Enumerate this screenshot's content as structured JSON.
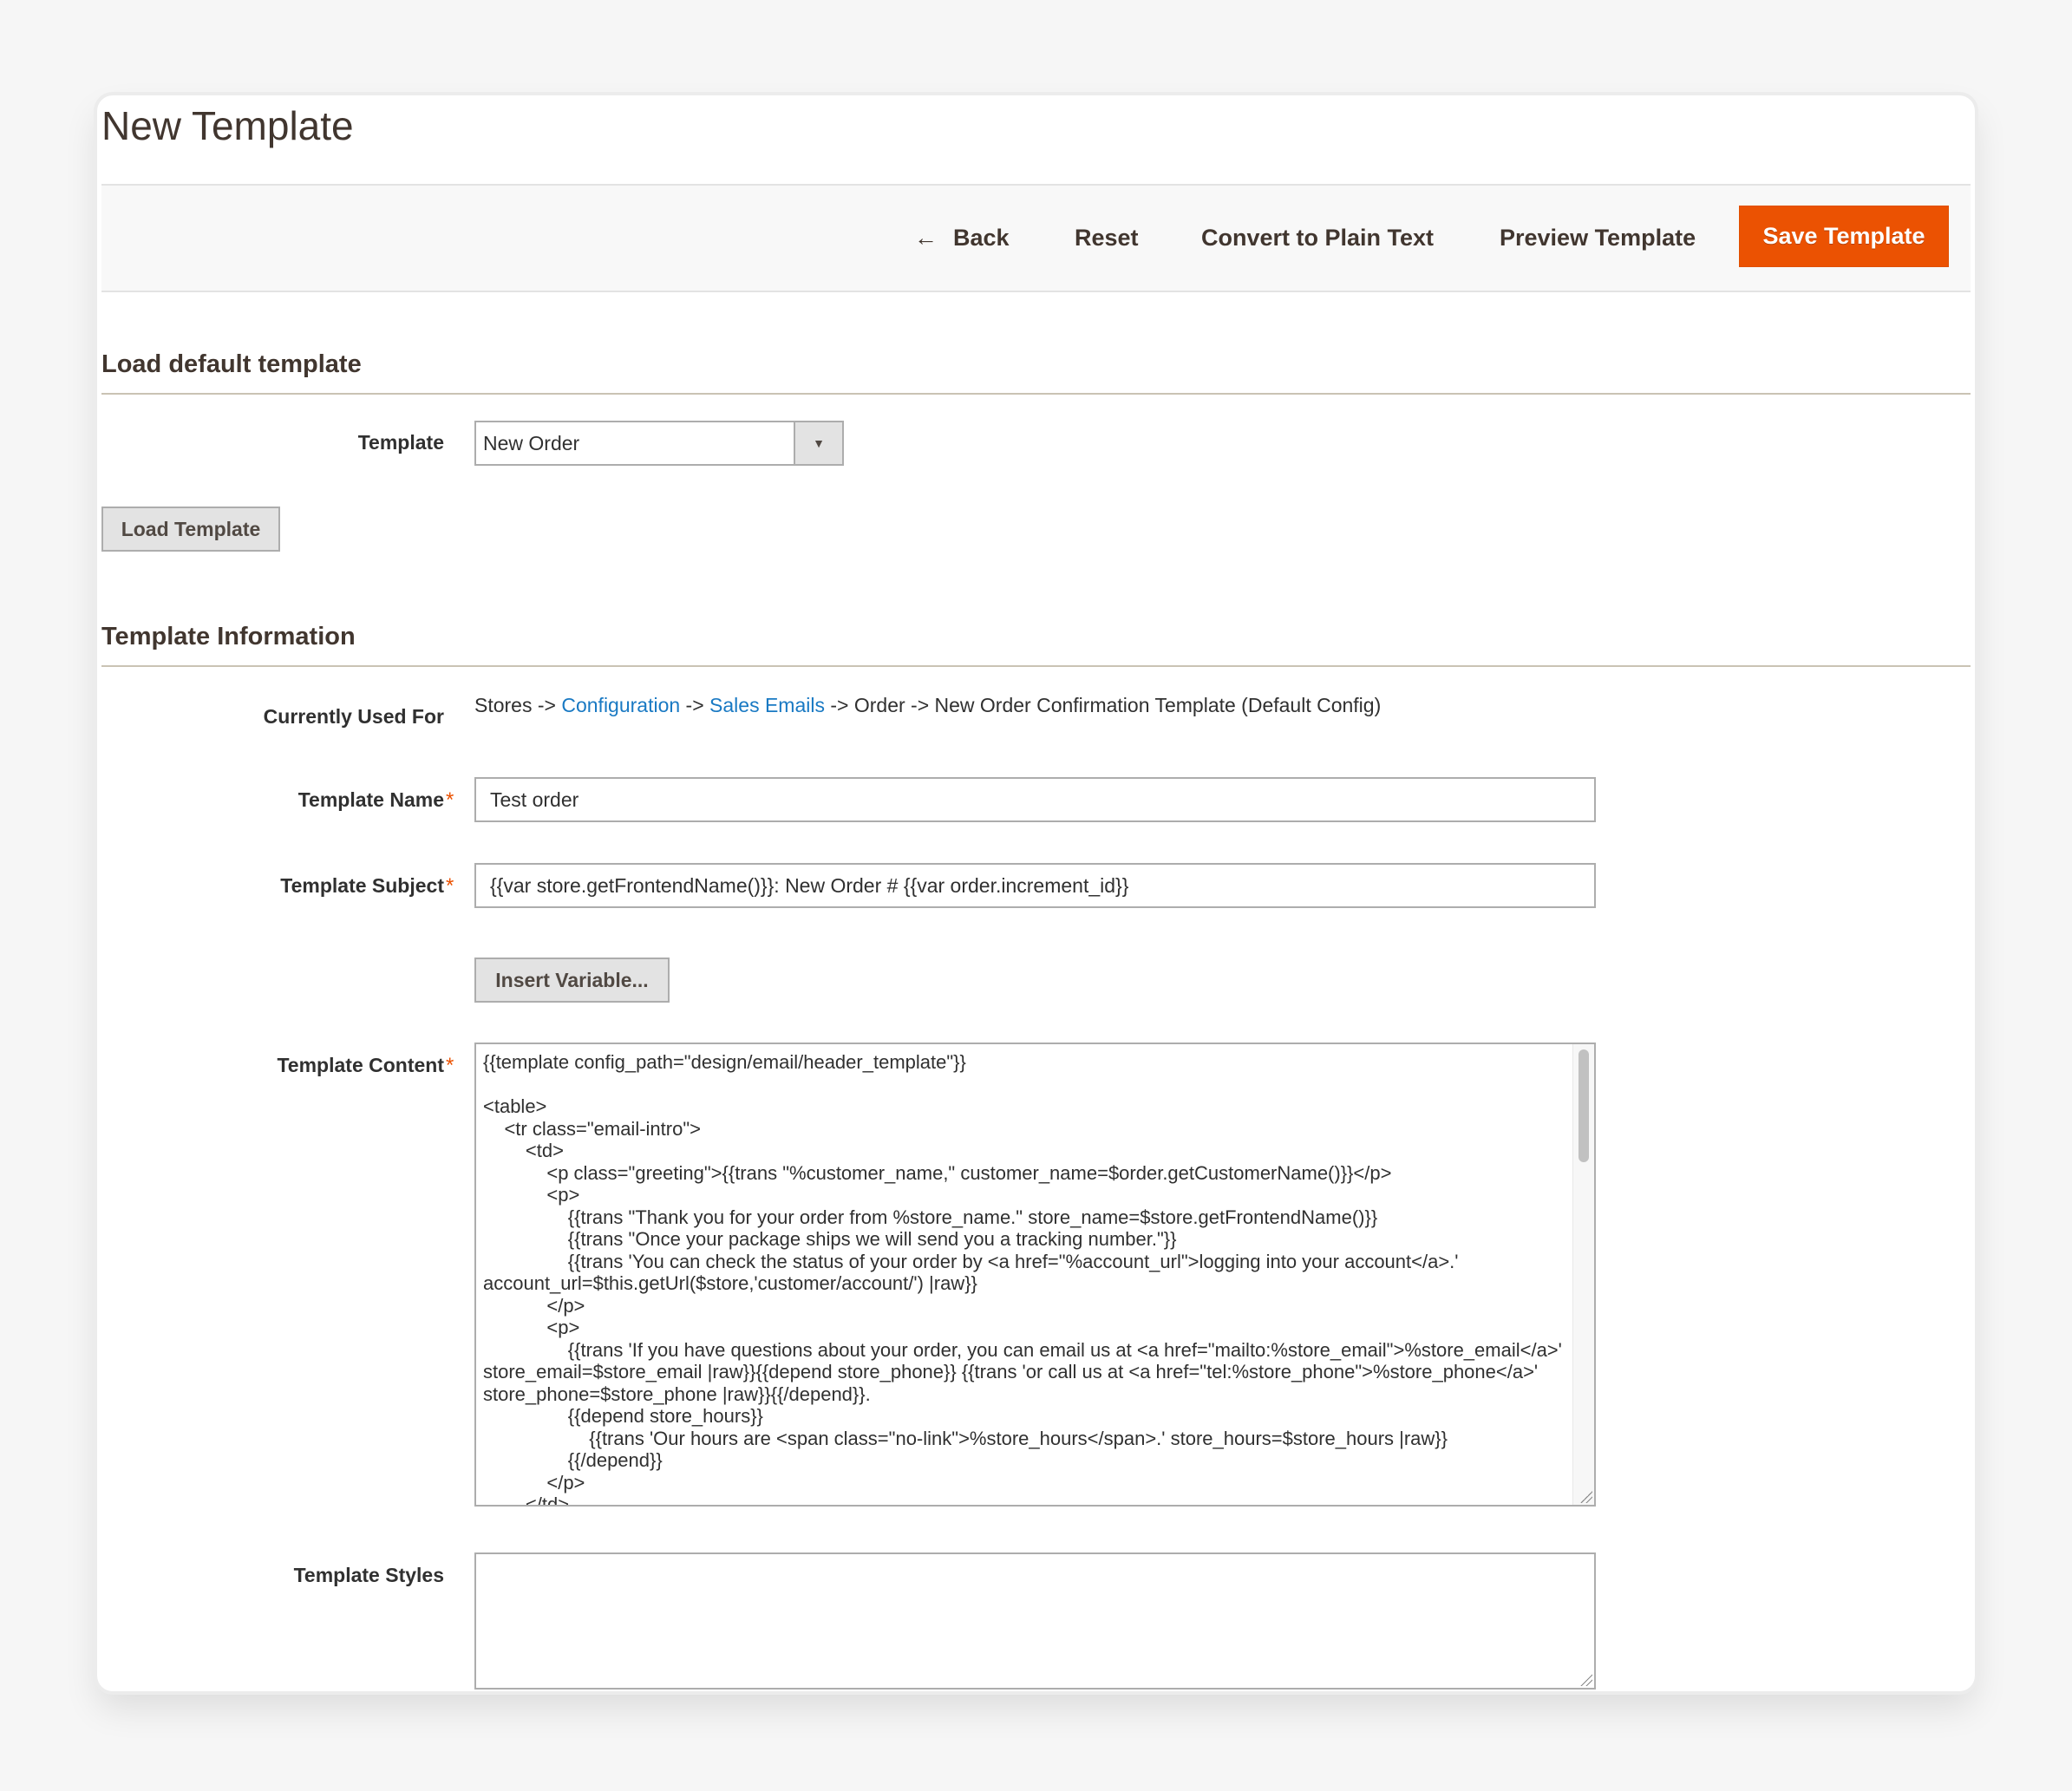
{
  "page": {
    "title": "New Template"
  },
  "toolbar": {
    "back_icon": "←",
    "back_label": "Back",
    "reset_label": "Reset",
    "convert_label": "Convert to Plain Text",
    "preview_label": "Preview Template",
    "save_label": "Save Template",
    "save_color": "#eb5202"
  },
  "load_section": {
    "title": "Load default template",
    "template_label": "Template",
    "template_selected": "New Order",
    "dropdown_icon": "▼",
    "load_button": "Load Template"
  },
  "info_section": {
    "title": "Template Information",
    "currently_used_label": "Currently Used For",
    "currently_used": {
      "part1": "Stores -> ",
      "link1": "Configuration",
      "part2": " -> ",
      "link2": "Sales Emails",
      "part3": " -> Order -> New Order Confirmation Template  (Default Config)"
    },
    "required_marker": "*",
    "name_label": "Template Name",
    "name_value": "Test order",
    "subject_label": "Template Subject",
    "subject_value": "{{var store.getFrontendName()}}: New Order # {{var order.increment_id}}",
    "insert_variable_button": "Insert Variable...",
    "content_label": "Template Content",
    "content_value": "{{template config_path=\"design/email/header_template\"}}\n\n<table>\n    <tr class=\"email-intro\">\n        <td>\n            <p class=\"greeting\">{{trans \"%customer_name,\" customer_name=$order.getCustomerName()}}</p>\n            <p>\n                {{trans \"Thank you for your order from %store_name.\" store_name=$store.getFrontendName()}}\n                {{trans \"Once your package ships we will send you a tracking number.\"}}\n                {{trans 'You can check the status of your order by <a href=\"%account_url\">logging into your account</a>.' account_url=$this.getUrl($store,'customer/account/') |raw}}\n            </p>\n            <p>\n                {{trans 'If you have questions about your order, you can email us at <a href=\"mailto:%store_email\">%store_email</a>' store_email=$store_email |raw}}{{depend store_phone}} {{trans 'or call us at <a href=\"tel:%store_phone\">%store_phone</a>' store_phone=$store_phone |raw}}{{/depend}}.\n                {{depend store_hours}}\n                    {{trans 'Our hours are <span class=\"no-link\">%store_hours</span>.' store_hours=$store_hours |raw}}\n                {{/depend}}\n            </p>\n        </td>",
    "styles_label": "Template Styles",
    "styles_value": ""
  }
}
